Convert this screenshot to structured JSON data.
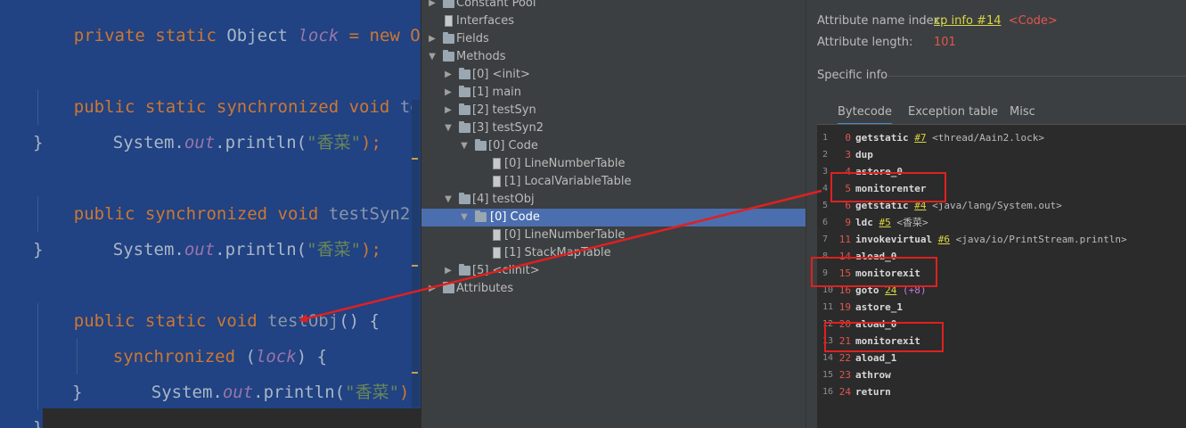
{
  "editor": {
    "line0": {
      "kw": "private static ",
      "type": "Object ",
      "field": "lock",
      "rest": " = new Object"
    },
    "line1": {
      "kw": "public static synchronized void ",
      "name": "testSyn"
    },
    "line2": {
      "recv": "System.",
      "field": "out",
      "call": ".println(",
      "str": "\"香菜\"",
      "end": ");"
    },
    "line3": "}",
    "line4": {
      "kw": "public synchronized void ",
      "name": "testSyn2",
      "rest": "() {"
    },
    "line5": {
      "recv": "System.",
      "field": "out",
      "call": ".println(",
      "str": "\"香菜\"",
      "end": ");"
    },
    "line6": "}",
    "line7": {
      "kw": "public static void ",
      "name": "testObj",
      "rest": "() {"
    },
    "line8": {
      "kw": "synchronized ",
      "open": "(",
      "field": "lock",
      "rest": ") {"
    },
    "line9": {
      "recv": "System.",
      "field": "out",
      "call": ".println(",
      "str": "\"香菜\"",
      "end": ");"
    },
    "line10": "}",
    "line11": "}"
  },
  "tree": {
    "rows": [
      {
        "label": "Constant Pool",
        "kind": "folder",
        "arrow": "right"
      },
      {
        "label": "Interfaces",
        "kind": "file",
        "arrow": ""
      },
      {
        "label": "Fields",
        "kind": "folder",
        "arrow": "right"
      },
      {
        "label": "Methods",
        "kind": "folder",
        "arrow": "down"
      },
      {
        "label": "[0] <init>",
        "kind": "folder",
        "arrow": "right"
      },
      {
        "label": "[1] main",
        "kind": "folder",
        "arrow": "right"
      },
      {
        "label": "[2] testSyn",
        "kind": "folder",
        "arrow": "right"
      },
      {
        "label": "[3] testSyn2",
        "kind": "folder",
        "arrow": "down"
      },
      {
        "label": "[0] Code",
        "kind": "folder",
        "arrow": "down"
      },
      {
        "label": "[0] LineNumberTable",
        "kind": "file",
        "arrow": ""
      },
      {
        "label": "[1] LocalVariableTable",
        "kind": "file",
        "arrow": ""
      },
      {
        "label": "[4] testObj",
        "kind": "folder",
        "arrow": "down"
      },
      {
        "label": "[0] Code",
        "kind": "folder",
        "arrow": "down",
        "selected": true
      },
      {
        "label": "[0] LineNumberTable",
        "kind": "file",
        "arrow": ""
      },
      {
        "label": "[1] StackMapTable",
        "kind": "file",
        "arrow": ""
      },
      {
        "label": "[5] <clinit>",
        "kind": "folder",
        "arrow": "right"
      },
      {
        "label": "Attributes",
        "kind": "folder",
        "arrow": "right"
      }
    ]
  },
  "info": {
    "name_index_label": "Attribute name index:",
    "name_index_link": "cp info #14",
    "name_index_value": "<Code>",
    "length_label": "Attribute length:",
    "length_value": "101",
    "section_title": "Specific info",
    "tabs": [
      "Bytecode",
      "Exception table",
      "Misc"
    ]
  },
  "bytecode": [
    {
      "ln": "1",
      "off": "0",
      "op": "getstatic",
      "arg": "#7",
      "cmt": "<thread/Aain2.lock>"
    },
    {
      "ln": "2",
      "off": "3",
      "op": "dup"
    },
    {
      "ln": "3",
      "off": "4",
      "op": "astore_0"
    },
    {
      "ln": "4",
      "off": "5",
      "op": "monitorenter"
    },
    {
      "ln": "5",
      "off": "6",
      "op": "getstatic",
      "arg": "#4",
      "cmt": "<java/lang/System.out>"
    },
    {
      "ln": "6",
      "off": "9",
      "op": "ldc",
      "arg": "#5",
      "cmt": "<香菜>"
    },
    {
      "ln": "7",
      "off": "11",
      "op": "invokevirtual",
      "arg": "#6",
      "cmt": "<java/io/PrintStream.println>"
    },
    {
      "ln": "8",
      "off": "14",
      "op": "aload_0"
    },
    {
      "ln": "9",
      "off": "15",
      "op": "monitorexit"
    },
    {
      "ln": "10",
      "off": "16",
      "op": "goto",
      "arg": "24",
      "mag": "(+8)"
    },
    {
      "ln": "11",
      "off": "19",
      "op": "astore_1"
    },
    {
      "ln": "12",
      "off": "20",
      "op": "aload_0"
    },
    {
      "ln": "13",
      "off": "21",
      "op": "monitorexit"
    },
    {
      "ln": "14",
      "off": "22",
      "op": "aload_1"
    },
    {
      "ln": "15",
      "off": "23",
      "op": "athrow"
    },
    {
      "ln": "16",
      "off": "24",
      "op": "return"
    }
  ],
  "colors": {
    "highlight_box": "#e02020",
    "arrow": "#e02020",
    "selection": "#4b6eaf"
  }
}
